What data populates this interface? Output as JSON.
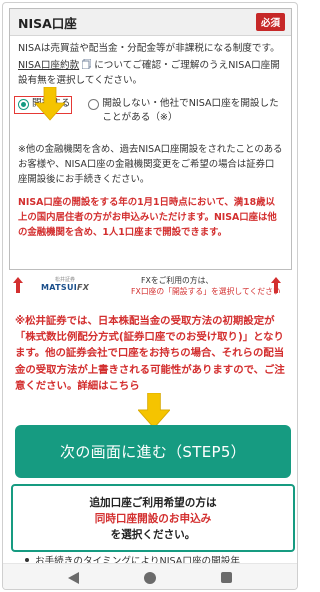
{
  "nisa": {
    "title": "NISA口座",
    "required_badge": "必須",
    "intro": "NISAは売買益や配当金・分配金等が非課税になる制度です。",
    "link_text": "NISA口座約款",
    "link_follow": "についてご確認・ご理解のうえNISA口座開設有無を選択してください。",
    "options": [
      {
        "label": "開設する",
        "selected": true
      },
      {
        "label": "開設しない・他社でNISA口座を開設したことがある（※）",
        "selected": false
      }
    ],
    "note": "※他の金融機関を含め、過去NISA口座開設をされたことのあるお客様や、NISA口座の金融機関変更をご希望の場合は証券口座開設後にお手続きください。",
    "red_note": "NISA口座の開設をする年の1月1日時点において、満18歳以上の国内居住者の方がお申込みいただけます。NISA口座は他の金融機関を含め、1人1口座まで開設できます。"
  },
  "fx": {
    "logo_small": "松井証券",
    "logo_main": "MATSUI",
    "logo_fx": "FX",
    "text1": "FXをご利用の方は、",
    "text2": "FX口座の「開設する」を選択してください"
  },
  "warning": "※松井証券では、日本株配当金の受取方法の初期設定が「株式数比例配分方式(証券口座でのお受け取り)」となります。他の証券会社で口座をお持ちの場合、それらの配当金の受取方法が上書きされる可能性がありますので、ご注意ください。詳細はこちら",
  "next_button": "次の画面に進む（STEP5）",
  "additional": {
    "line1": "追加口座ご利用希望の方は",
    "line2": "同時口座開設のお申込み",
    "line3": "を選択ください。"
  },
  "bottom_text": "お手続きのタイミングによりNISA口座の開設年",
  "colors": {
    "accent": "#169b81",
    "alert": "#d32f2f",
    "arrow": "#f5c400"
  }
}
